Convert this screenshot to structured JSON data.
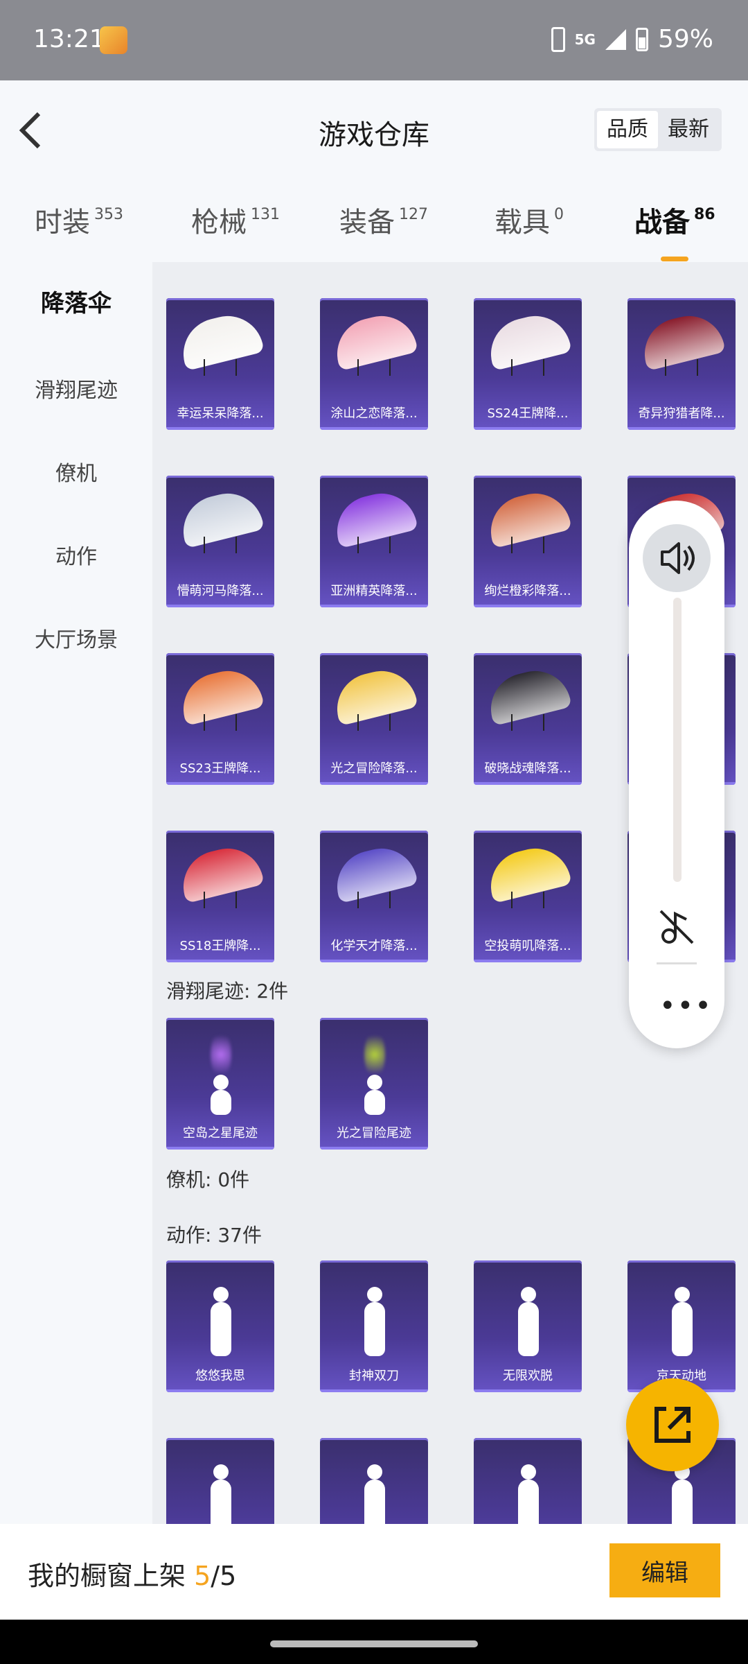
{
  "status_bar": {
    "time": "13:21",
    "network": "5G",
    "battery": "59%"
  },
  "header": {
    "title": "游戏仓库",
    "sort_quality": "品质",
    "sort_latest": "最新"
  },
  "tabs": [
    {
      "label": "时装",
      "count": "353"
    },
    {
      "label": "枪械",
      "count": "131"
    },
    {
      "label": "装备",
      "count": "127"
    },
    {
      "label": "载具",
      "count": "0"
    },
    {
      "label": "战备",
      "count": "86"
    }
  ],
  "sidebar": [
    "降落伞",
    "滑翔尾迹",
    "僚机",
    "动作",
    "大厅场景"
  ],
  "parachutes": [
    {
      "label": "幸运呆呆降落...",
      "color": "#f3f1ee"
    },
    {
      "label": "涂山之恋降落...",
      "color": "#f3a7b8"
    },
    {
      "label": "SS24王牌降...",
      "color": "#eadde3"
    },
    {
      "label": "奇异狩猎者降...",
      "color": "#8a1e2e"
    },
    {
      "label": "懵萌河马降落...",
      "color": "#c7cfdc"
    },
    {
      "label": "亚洲精英降落...",
      "color": "#8a3ee0"
    },
    {
      "label": "绚烂橙彩降落...",
      "color": "#d36a44"
    },
    {
      "label": "",
      "color": "#d23a3a"
    },
    {
      "label": "SS23王牌降...",
      "color": "#e9783e"
    },
    {
      "label": "光之冒险降落...",
      "color": "#f2c64a"
    },
    {
      "label": "破晓战魂降落...",
      "color": "#2d2b33"
    },
    {
      "label": "",
      "color": "#5d4bb3"
    },
    {
      "label": "SS18王牌降...",
      "color": "#d93240"
    },
    {
      "label": "化学天才降落...",
      "color": "#5d4fc8"
    },
    {
      "label": "空投萌叽降落...",
      "color": "#f4cc22"
    },
    {
      "label": "",
      "color": "#555555"
    }
  ],
  "trails_header": "滑翔尾迹: 2件",
  "trails": [
    {
      "label": "空岛之星尾迹",
      "color": "#b46ef0"
    },
    {
      "label": "光之冒险尾迹",
      "color": "#b4d23a"
    }
  ],
  "wingman_header": "僚机: 0件",
  "emotes_header": "动作: 37件",
  "emotes": [
    {
      "label": "悠悠我思"
    },
    {
      "label": "封神双刀"
    },
    {
      "label": "无限欢脱"
    },
    {
      "label": "京天动地"
    },
    {
      "label": ""
    },
    {
      "label": ""
    },
    {
      "label": ""
    },
    {
      "label": ""
    }
  ],
  "bottom": {
    "text": "我的橱窗上架 ",
    "current": "5",
    "total": "/5",
    "edit": "编辑"
  }
}
